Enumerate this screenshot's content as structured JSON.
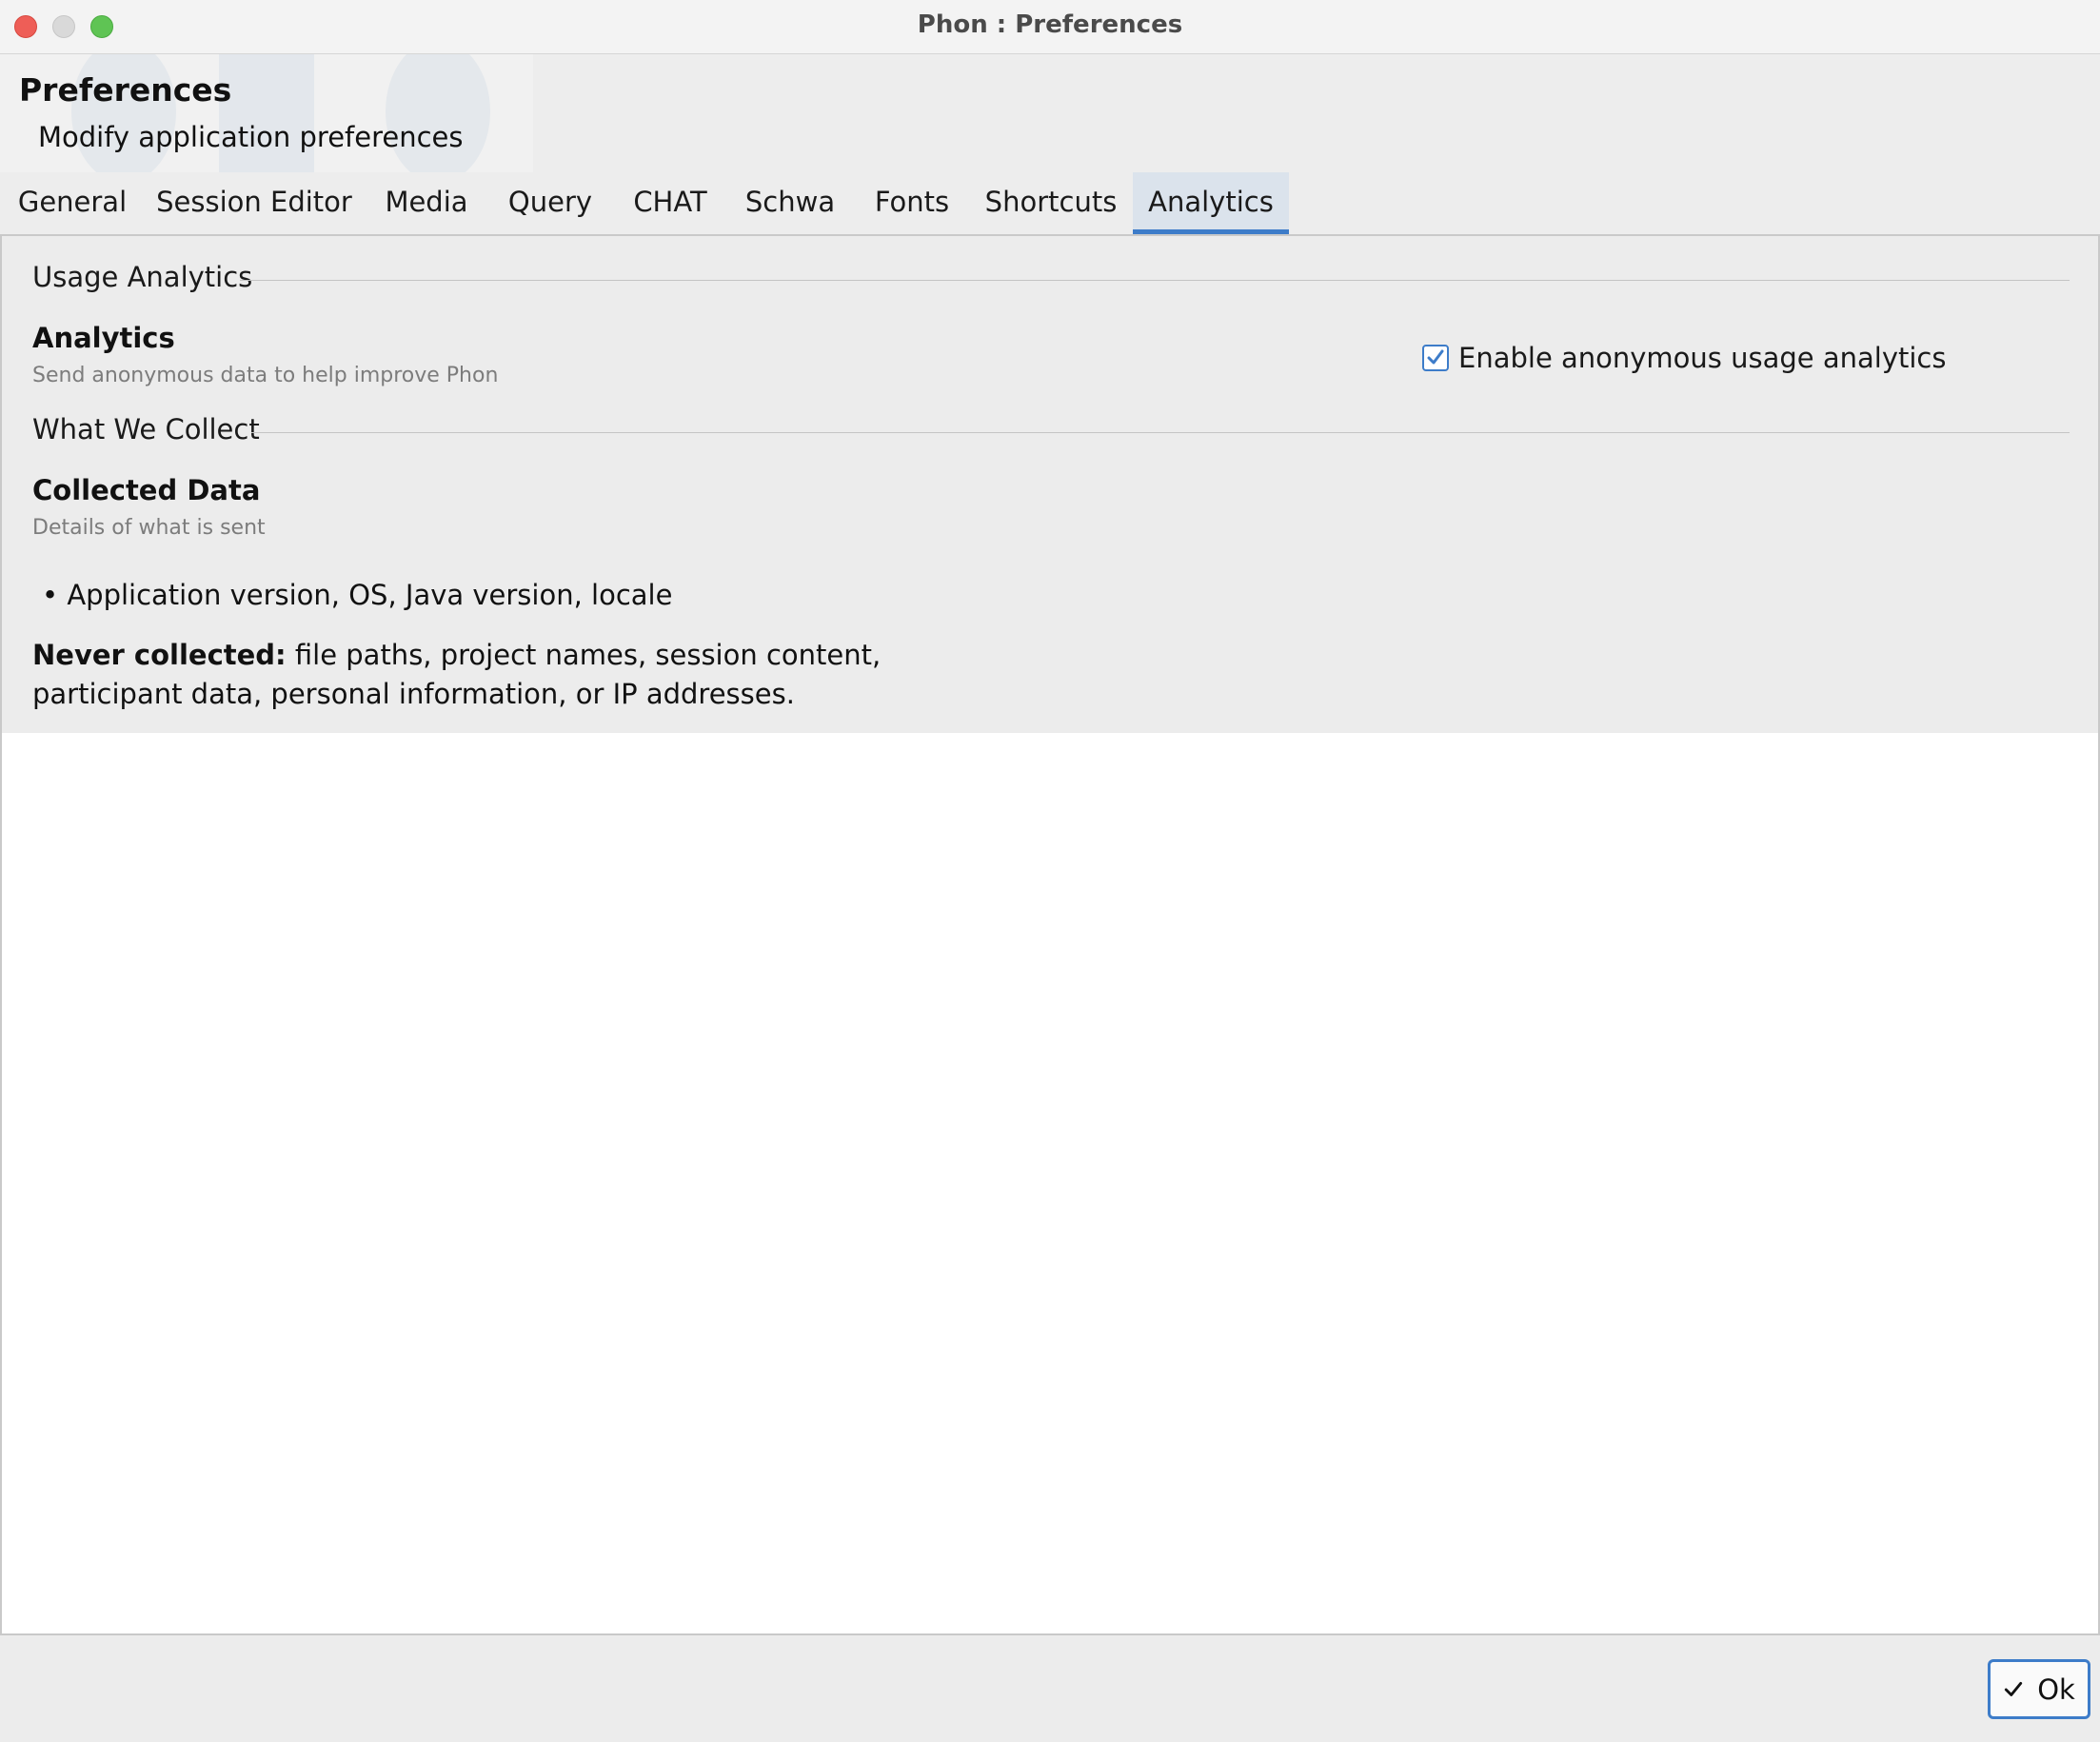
{
  "window": {
    "title": "Phon : Preferences"
  },
  "header": {
    "title": "Preferences",
    "subtitle": "Modify application preferences"
  },
  "tabs": [
    {
      "label": "General"
    },
    {
      "label": "Session Editor"
    },
    {
      "label": "Media"
    },
    {
      "label": "Query"
    },
    {
      "label": "CHAT"
    },
    {
      "label": "Schwa"
    },
    {
      "label": "Fonts"
    },
    {
      "label": "Shortcuts"
    },
    {
      "label": "Analytics",
      "active": true
    }
  ],
  "usage": {
    "section_title": "Usage Analytics",
    "label": "Analytics",
    "description": "Send anonymous data to help improve Phon",
    "checkbox_label": "Enable anonymous usage analytics",
    "checked": true
  },
  "collect": {
    "section_title": "What We Collect",
    "label": "Collected Data",
    "description": "Details of what is sent",
    "bullet": "• Application version, OS, Java version, locale",
    "never_prefix": "Never collected:",
    "never_text": " file paths, project names, session content, participant data, personal information, or IP addresses."
  },
  "footer": {
    "ok_label": "Ok"
  },
  "colors": {
    "accent": "#3d7cc9",
    "close": "#ee5e57",
    "maximize": "#5fc454"
  }
}
